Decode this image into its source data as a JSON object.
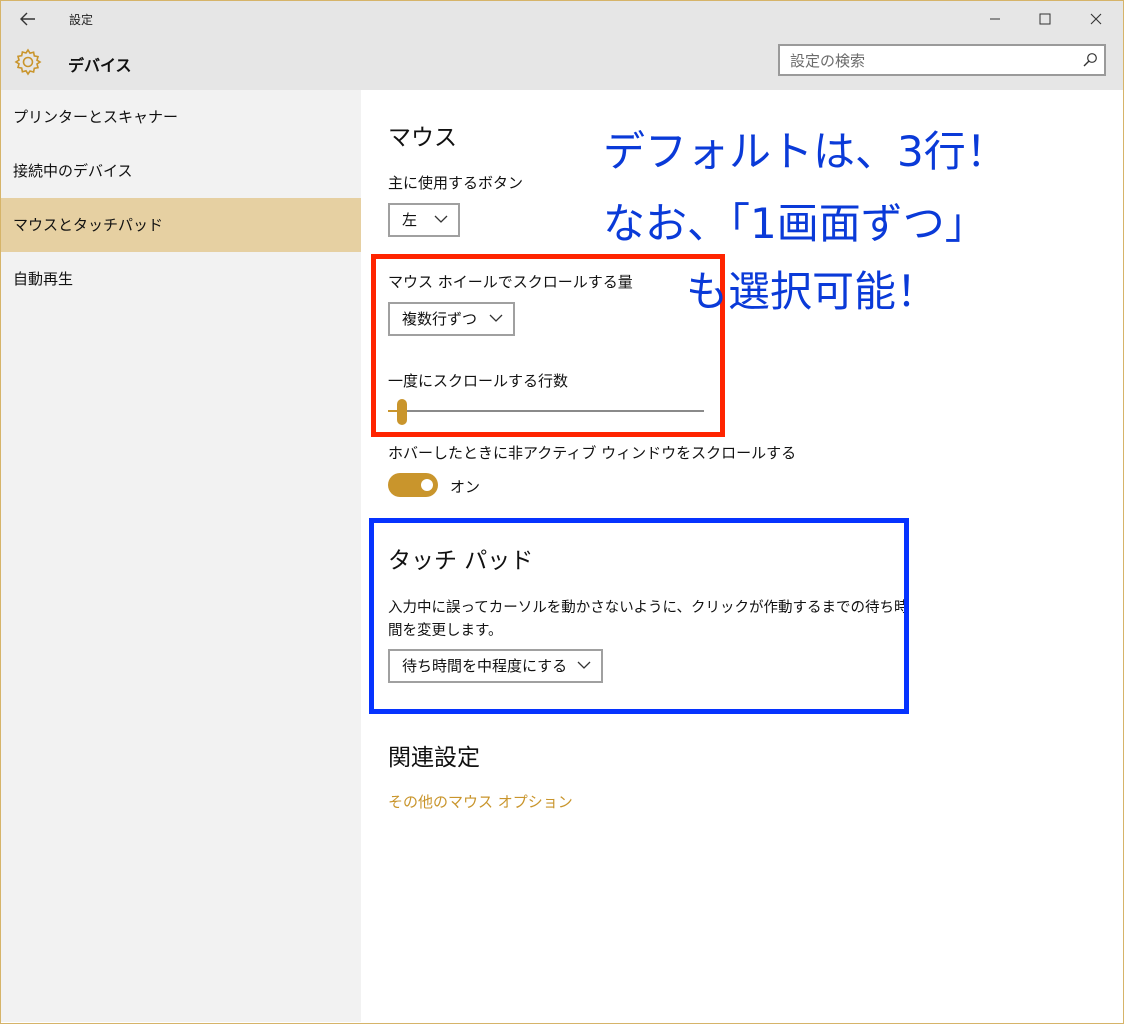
{
  "window": {
    "title": "設定"
  },
  "header": {
    "section_title": "デバイス",
    "search_placeholder": "設定の検索"
  },
  "sidebar": {
    "items": [
      {
        "label": "プリンターとスキャナー",
        "selected": false
      },
      {
        "label": "接続中のデバイス",
        "selected": false
      },
      {
        "label": "マウスとタッチパッド",
        "selected": true
      },
      {
        "label": "自動再生",
        "selected": false
      }
    ]
  },
  "mouse": {
    "heading": "マウス",
    "primary_button_label": "主に使用するボタン",
    "primary_button_value": "左",
    "wheel_label": "マウス ホイールでスクロールする量",
    "wheel_value": "複数行ずつ",
    "lines_label": "一度にスクロールする行数",
    "lines_value_fraction": 0.03,
    "inactive_scroll_label": "ホバーしたときに非アクティブ ウィンドウをスクロールする",
    "inactive_scroll_state": "オン"
  },
  "touchpad": {
    "heading": "タッチ パッド",
    "description_line1": "入力中に誤ってカーソルを動かさないように、クリックが作動するまでの待ち時",
    "description_line2": "間を変更します。",
    "delay_value": "待ち時間を中程度にする"
  },
  "related": {
    "heading": "関連設定",
    "link": "その他のマウス オプション"
  },
  "annotation": {
    "line1": "デフォルトは、3行！",
    "line2": "なお、「1画面ずつ」",
    "line3": "も選択可能！"
  },
  "colors": {
    "accent": "#c9952c",
    "selected_nav": "#e6d0a2",
    "red_box": "#ff2400",
    "blue_box": "#0633ff",
    "annotation_text": "#0a3ad8"
  }
}
